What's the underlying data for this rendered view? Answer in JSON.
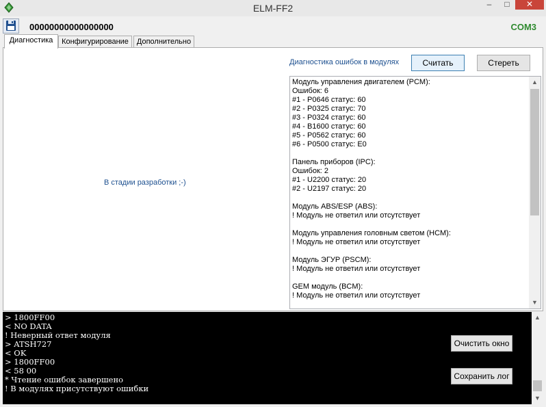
{
  "window": {
    "title": "ELM-FF2",
    "minimize_glyph": "–",
    "maximize_glyph": "□",
    "close_glyph": "✕"
  },
  "toolbar": {
    "vin": "00000000000000000",
    "port": "COM3",
    "save_icon": "floppy-disk-icon"
  },
  "tabs": [
    {
      "label": "Диагностика",
      "active": true
    },
    {
      "label": "Конфигурирование",
      "active": false
    },
    {
      "label": "Дополнительно",
      "active": false
    }
  ],
  "diagnostics": {
    "left_placeholder": "В стадии разработки ;-)",
    "section_label": "Диагностика ошибок в модулях",
    "read_button": "Считать",
    "clear_button": "Стереть",
    "results": "Модуль управления двигателем (PCM):\nОшибок: 6\n#1 - P0646 статус: 60\n#2 - P0325 статус: 70\n#3 - P0324 статус: 60\n#4 - B1600 статус: 60\n#5 - P0562 статус: 60\n#6 - P0500 статус: E0\n\nПанель приборов (IPC):\nОшибок: 2\n#1 - U2200 статус: 20\n#2 - U2197 статус: 20\n\nМодуль ABS/ESP (ABS):\n! Модуль не ответил или отсутствует\n\nМодуль управления головным светом (HCM):\n! Модуль не ответил или отсутствует\n\nМодуль ЭГУР (PSCM):\n! Модуль не ответил или отсутствует\n\nGEM модуль (BCM):\n! Модуль не ответил или отсутствует"
  },
  "console": {
    "log": "> 1800FF00\n< NO DATA\n! Неверный ответ модуля\n> ATSH727\n< OK\n> 1800FF00\n< 58 00\n* Чтение ошибок завершено\n! В модулях присутствуют ошибки",
    "clear_button": "Очистить окно",
    "save_button": "Сохранить лог"
  },
  "colors": {
    "accent_text": "#1c4f8f",
    "port_ok": "#2f8a2f",
    "close_button": "#c9453a"
  }
}
